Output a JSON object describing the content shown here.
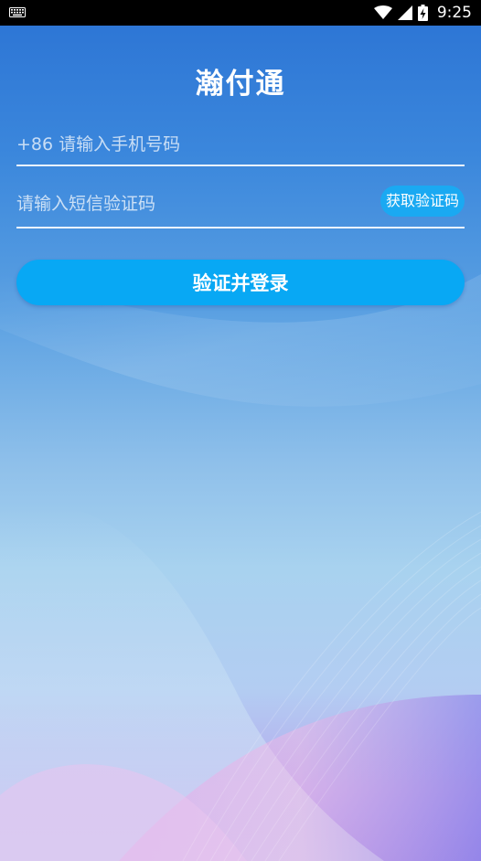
{
  "status_bar": {
    "time": "9:25",
    "icons": [
      "keyboard-icon",
      "wifi-icon",
      "signal-icon",
      "battery-charging-icon"
    ]
  },
  "app": {
    "title": "瀚付通"
  },
  "form": {
    "phone_placeholder": "+86 请输入手机号码",
    "code_placeholder": "请输入短信验证码",
    "get_code_label": "获取验证码",
    "submit_label": "验证并登录"
  },
  "colors": {
    "accent": "#08a8f4",
    "background_top": "#2b73d4",
    "background_bottom": "#a393ea"
  }
}
